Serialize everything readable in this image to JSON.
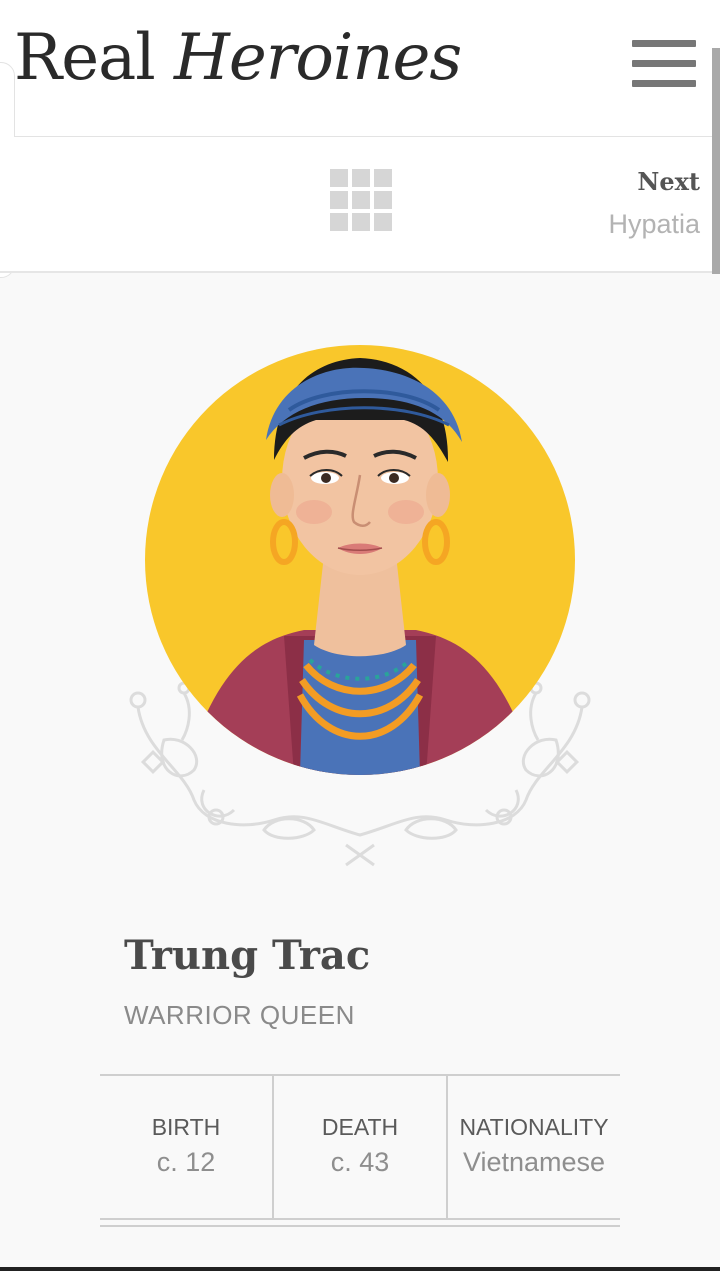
{
  "header": {
    "logo_text_1": "Real ",
    "logo_text_2": "Heroines",
    "menu_icon": "hamburger-icon"
  },
  "nav": {
    "grid_icon": "grid-icon",
    "next_label": "Next",
    "next_name": "Hypatia"
  },
  "hero": {
    "name": "Trung Trac",
    "title": "WARRIOR QUEEN"
  },
  "facts": [
    {
      "label": "BIRTH",
      "value": "c. 12"
    },
    {
      "label": "DEATH",
      "value": "c. 43"
    },
    {
      "label": "NATIONALITY",
      "value": "Vietnamese"
    }
  ],
  "colors": {
    "portrait_bg": "#f9c72b",
    "headband": "#4a73b8",
    "jacket": "#a43e57",
    "earrings": "#f5a623",
    "necklace": "#f39c24",
    "skin": "#f2c4a2",
    "hair": "#1c1c1c"
  }
}
